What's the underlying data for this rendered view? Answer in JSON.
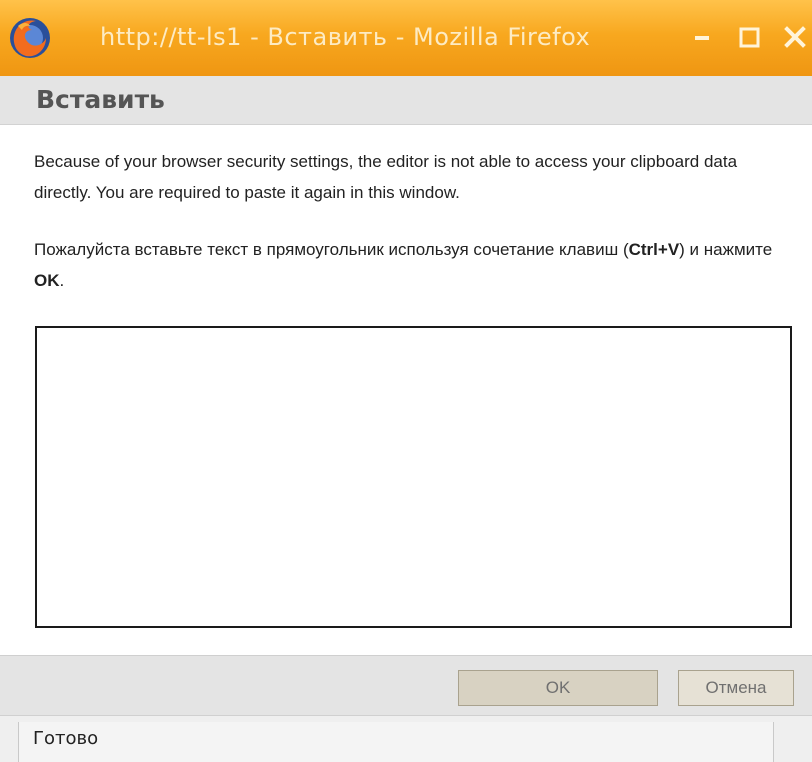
{
  "window": {
    "title": "http://tt-ls1 - Вставить - Mozilla Firefox",
    "controls": {
      "minimize_icon": "minimize-icon",
      "maximize_icon": "maximize-icon",
      "close_icon": "close-icon"
    },
    "colors": {
      "titlebar": "#f8a81f",
      "title_text": "#fdebc3"
    }
  },
  "dialog": {
    "title": "Вставить",
    "security_message": "Because of your browser security settings, the editor is not able to access your clipboard data directly. You are required to paste it again in this window.",
    "instruction": {
      "before_shortcut": "Пожалуйста вставьте текст в прямоугольник используя сочетание клавиш (",
      "shortcut": "Ctrl+V",
      "middle": ") и нажмите ",
      "ok_word": "OK",
      "after": "."
    },
    "paste_area": {
      "value": ""
    },
    "buttons": {
      "ok_label": "OK",
      "cancel_label": "Отмена"
    }
  },
  "statusbar": {
    "text": "Готово"
  }
}
